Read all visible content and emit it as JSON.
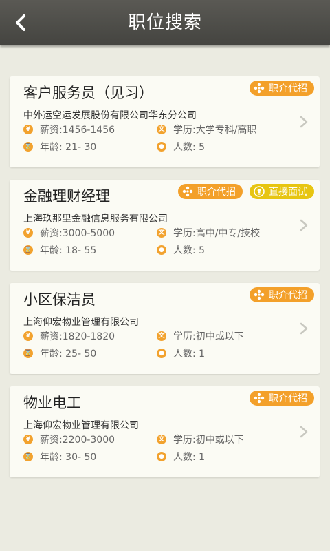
{
  "header": {
    "title": "职位搜索"
  },
  "jobs": [
    {
      "title": "客户服务员（见习）",
      "company": "中外运空运发展股份有限公司华东分公司",
      "salary": "薪资:1456-1456",
      "education": "学历:大学专科/高职",
      "age": "年龄: 21- 30",
      "headcount": "人数:  5",
      "tags": [
        "职介代招"
      ]
    },
    {
      "title": "金融理财经理",
      "company": "上海玖那里金融信息服务有限公司",
      "salary": "薪资:3000-5000",
      "education": "学历:高中/中专/技校",
      "age": "年龄: 18- 55",
      "headcount": "人数:  5",
      "tags": [
        "职介代招",
        "直接面试"
      ]
    },
    {
      "title": "小区保洁员",
      "company": "上海仰宏物业管理有限公司",
      "salary": "薪资:1820-1820",
      "education": "学历:初中或以下",
      "age": "年龄: 25- 50",
      "headcount": "人数:  1",
      "tags": [
        "职介代招"
      ]
    },
    {
      "title": "物业电工",
      "company": "上海仰宏物业管理有限公司",
      "salary": "薪资:2200-3000",
      "education": "学历:初中或以下",
      "age": "年龄: 30- 50",
      "headcount": "人数:  1",
      "tags": [
        "职介代招"
      ]
    }
  ],
  "icons": {
    "salary": "yen-icon",
    "education": "document-icon",
    "age": "hourglass-icon",
    "headcount": "person-icon",
    "tag_agency": "asterisk-icon",
    "tag_interview": "bulb-icon"
  },
  "colors": {
    "accent": "#f3a02a",
    "interview": "#e7c511",
    "header": "#4f4e4a",
    "background": "#ebebe1"
  }
}
